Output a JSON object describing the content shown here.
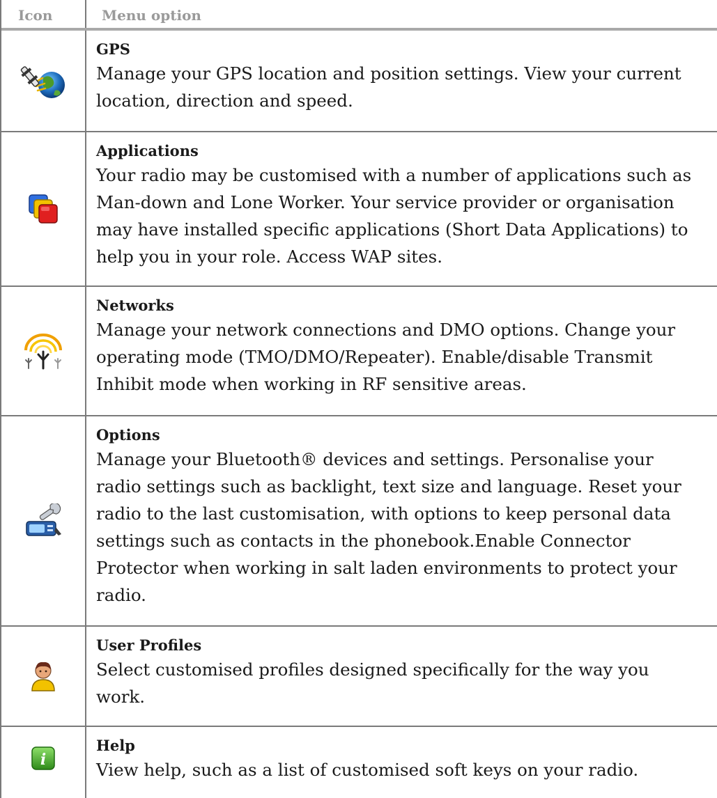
{
  "header": {
    "icon_col": "Icon",
    "option_col": "Menu option"
  },
  "rows": [
    {
      "icon": "gps-satellite-globe-icon",
      "title": "GPS",
      "description": "Manage your GPS location and position settings. View your current location, direction and speed."
    },
    {
      "icon": "applications-stacked-windows-icon",
      "title": "Applications",
      "description": "Your radio may be customised with a number of applications such as Man-down and Lone Worker. Your service provider or organisation may have installed specific applications (Short Data Applications) to help you in your role. Access WAP sites."
    },
    {
      "icon": "network-antenna-icon",
      "title": "Networks",
      "description": "Manage your network connections and DMO options. Change your operating mode (TMO/DMO/Repeater). Enable/disable Transmit Inhibit mode when working in RF sensitive areas."
    },
    {
      "icon": "options-wrench-radio-icon",
      "title": "Options",
      "description": "Manage your Bluetooth® devices and settings. Personalise your radio settings such as backlight, text size and language. Reset your radio to the last customisation, with options to keep personal data settings such as contacts in the phonebook.Enable Connector Protector when working in salt laden environments to protect your radio."
    },
    {
      "icon": "user-profile-person-icon",
      "title": "User Profiles",
      "description": "Select customised profiles designed specifically for the way you work."
    },
    {
      "icon": "help-info-icon",
      "title": "Help",
      "description": "View help, such as a list of customised soft keys on your radio."
    }
  ]
}
